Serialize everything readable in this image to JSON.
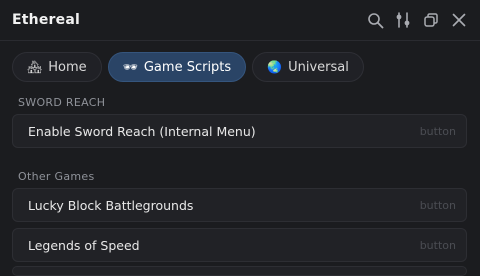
{
  "window": {
    "title": "Ethereal",
    "icons": [
      "search-icon",
      "sliders-icon",
      "window-copy-icon",
      "close-icon"
    ]
  },
  "tabs": [
    {
      "emoji": "🏘",
      "label": "Home",
      "active": false
    },
    {
      "emoji": "🕶",
      "label": "Game Scripts",
      "active": true
    },
    {
      "emoji": "🌏",
      "label": "Universal",
      "active": false
    }
  ],
  "sections": [
    {
      "title": "SWORD REACH",
      "rows": [
        {
          "label": "Enable Sword Reach (Internal Menu)",
          "hint": "button"
        }
      ]
    },
    {
      "title": "Other Games",
      "rows": [
        {
          "label": "Lucky Block Battlegrounds",
          "hint": "button"
        },
        {
          "label": "Legends of Speed",
          "hint": "button"
        }
      ]
    }
  ],
  "colors": {
    "background": "#1b1c1f",
    "active_tab": "#2a4466",
    "row_bg": "#212226"
  }
}
